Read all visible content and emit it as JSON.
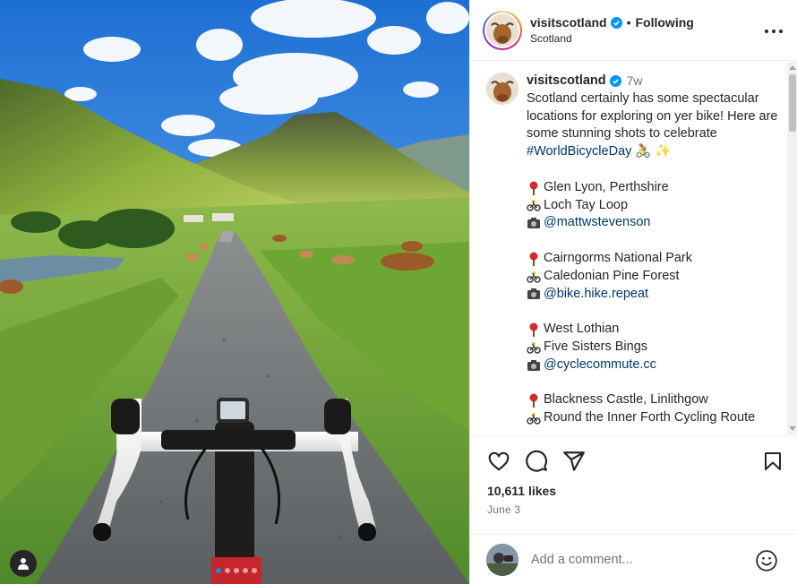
{
  "post": {
    "username": "visitscotland",
    "follow_status": "Following",
    "separator": "•",
    "location": "Scotland"
  },
  "caption": {
    "username": "visitscotland",
    "time_ago": "7w",
    "intro": "Scotland certainly has some spectacular locations for exploring on yer bike! Here are some stunning shots to celebrate",
    "hashtag": "#WorldBicycleDay",
    "intro_emoji": "🚴 ✨",
    "entries": [
      {
        "place": "Glen Lyon, Perthshire",
        "route": "Loch Tay Loop",
        "credit": "@mattwstevenson"
      },
      {
        "place": "Cairngorms National Park",
        "route": "Caledonian Pine Forest",
        "credit": "@bike.hike.repeat"
      },
      {
        "place": "West Lothian",
        "route": "Five Sisters Bings",
        "credit": "@cyclecommute.cc"
      },
      {
        "place": "Blackness Castle, Linlithgow",
        "route": "Round the Inner Forth Cycling Route",
        "credit": ""
      }
    ]
  },
  "actions": {
    "likes": "10,611 likes",
    "date": "June 3"
  },
  "comment": {
    "placeholder": "Add a comment..."
  },
  "carousel": {
    "count": 5,
    "active": 0
  },
  "colors": {
    "link": "#00376b",
    "accent": "#0095f6",
    "muted": "#737373",
    "text": "#262626"
  },
  "icons": [
    "user-tag-icon",
    "more-options-icon",
    "verified-badge-icon",
    "like-heart-icon",
    "comment-bubble-icon",
    "share-paper-plane-icon",
    "save-bookmark-icon",
    "emoji-icon",
    "pin-icon",
    "bicycle-icon",
    "camera-icon"
  ]
}
